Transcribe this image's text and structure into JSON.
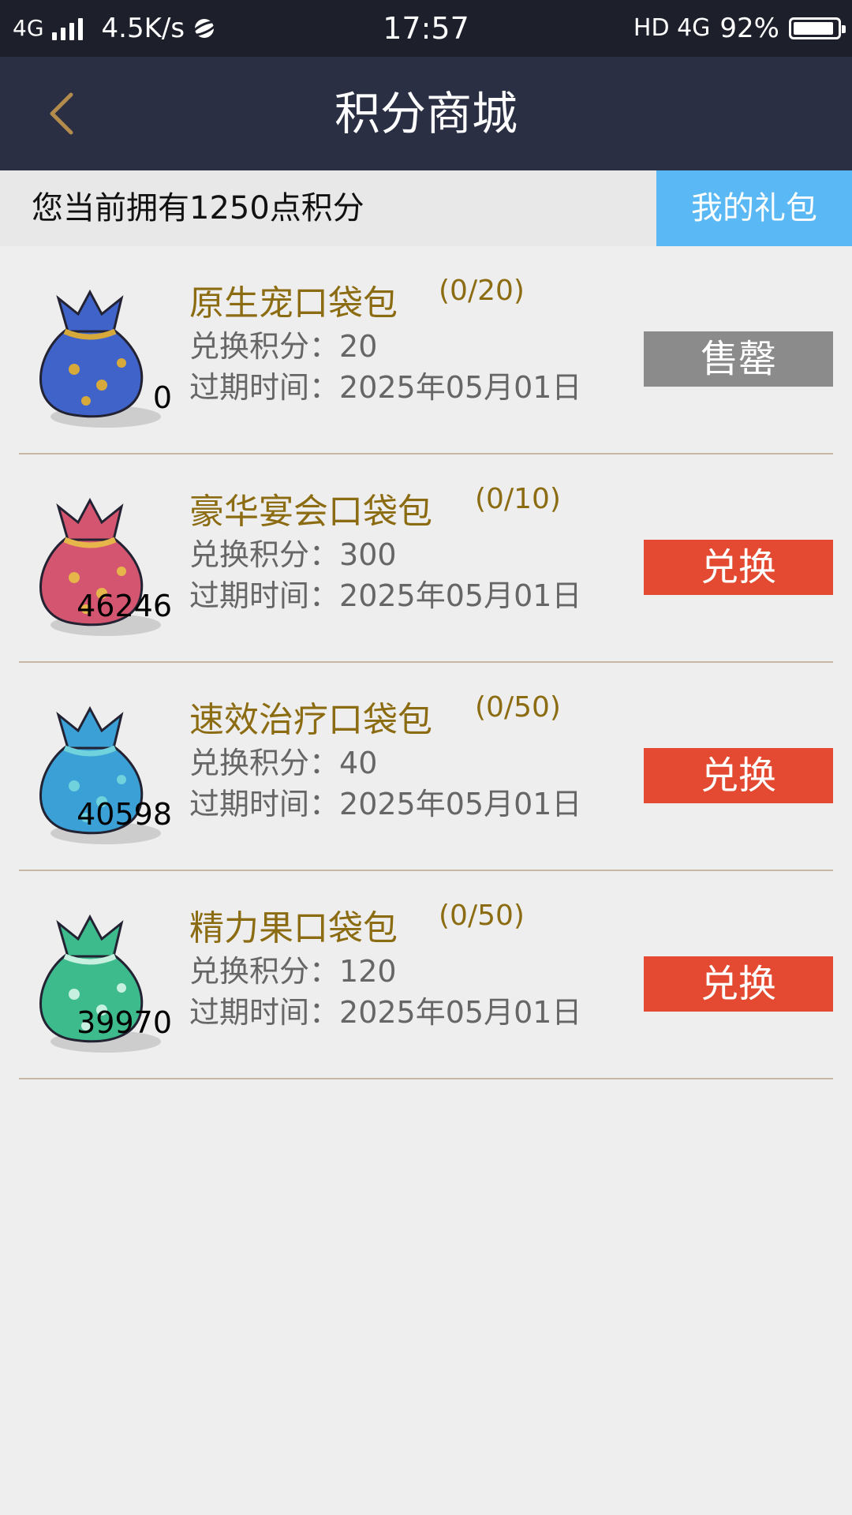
{
  "status_bar": {
    "network": "4G",
    "speed": "4.5K/s",
    "time": "17:57",
    "right_network": "HD 4G",
    "battery": "92%",
    "battery_level": 0.92
  },
  "nav": {
    "title": "积分商城"
  },
  "points": {
    "text": "您当前拥有1250点积分",
    "gift_button": "我的礼包"
  },
  "items": [
    {
      "name": "原生宠口袋包",
      "limit": "(0/20)",
      "price_label": "兑换积分：",
      "price": "20",
      "expire_label": "过期时间：",
      "expire": "2025年05月01日",
      "count": "0",
      "action": "售罄",
      "status": "sold",
      "bag_color": "#3f63c8",
      "bag_accent": "#d6a93a"
    },
    {
      "name": "豪华宴会口袋包",
      "limit": "(0/10)",
      "price_label": "兑换积分：",
      "price": "300",
      "expire_label": "过期时间：",
      "expire": "2025年05月01日",
      "count": "46246",
      "action": "兑换",
      "status": "redeem",
      "bag_color": "#d45570",
      "bag_accent": "#e6b64a"
    },
    {
      "name": "速效治疗口袋包",
      "limit": "(0/50)",
      "price_label": "兑换积分：",
      "price": "40",
      "expire_label": "过期时间：",
      "expire": "2025年05月01日",
      "count": "40598",
      "action": "兑换",
      "status": "redeem",
      "bag_color": "#3aa0d6",
      "bag_accent": "#6fd2dc"
    },
    {
      "name": "精力果口袋包",
      "limit": "(0/50)",
      "price_label": "兑换积分：",
      "price": "120",
      "expire_label": "过期时间：",
      "expire": "2025年05月01日",
      "count": "39970",
      "action": "兑换",
      "status": "redeem",
      "bag_color": "#3dbb8c",
      "bag_accent": "#c7f0e0"
    }
  ]
}
